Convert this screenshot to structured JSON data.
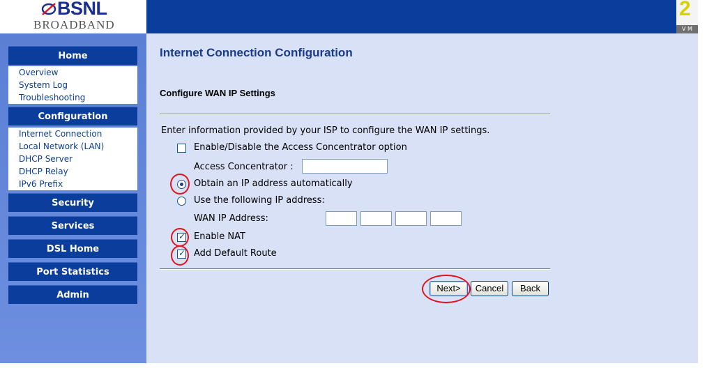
{
  "logo": {
    "brand": "BSNL",
    "sub": "BROADBAND"
  },
  "header_right": {
    "num": "2",
    "strip": "V   M"
  },
  "sidebar": {
    "home": {
      "label": "Home",
      "items": [
        "Overview",
        "System Log",
        "Troubleshooting"
      ]
    },
    "configuration": {
      "label": "Configuration",
      "items": [
        "Internet Connection",
        "Local Network (LAN)",
        "DHCP Server",
        "DHCP Relay",
        "IPv6 Prefix"
      ]
    },
    "security": "Security",
    "services": "Services",
    "dsl_home": "DSL Home",
    "port_statistics": "Port Statistics",
    "admin": "Admin"
  },
  "main": {
    "title": "Internet Connection Configuration",
    "section": "Configure WAN IP Settings",
    "intro": "Enter information provided by your ISP to configure the WAN IP settings.",
    "ac_option": {
      "label": "Enable/Disable the Access Concentrator option",
      "checked": false
    },
    "ac_label": "Access Concentrator :",
    "ac_value": "",
    "obtain_auto": {
      "label": "Obtain an IP address automatically",
      "selected": true
    },
    "use_following": {
      "label": "Use the following IP address:",
      "selected": false
    },
    "wan_ip_label": "WAN IP Address:",
    "wan_ip": [
      "",
      "",
      "",
      ""
    ],
    "enable_nat": {
      "label": "Enable NAT",
      "checked": true
    },
    "default_route": {
      "label": "Add Default Route",
      "checked": true
    },
    "buttons": {
      "next": "Next>",
      "cancel": "Cancel",
      "back": "Back"
    }
  },
  "colors": {
    "header": "#0a3d9c",
    "sidebar": "#6e8fe0",
    "content": "#d9e1f7",
    "annotation": "#e0141e"
  }
}
